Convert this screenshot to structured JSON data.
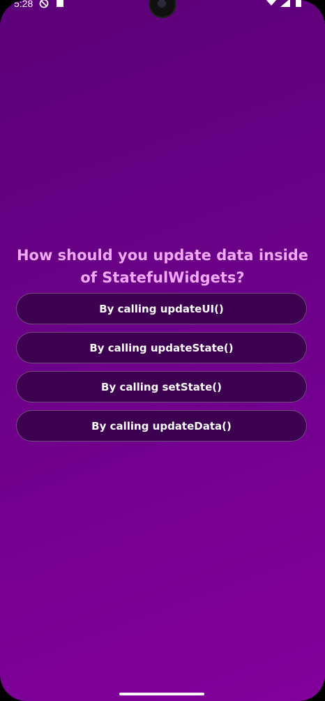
{
  "status": {
    "time": "5:28",
    "icons": [
      "do-not-disturb-icon",
      "sd-card-icon",
      "wifi-icon",
      "signal-icon",
      "battery-icon"
    ]
  },
  "quiz": {
    "question": "How should you update data inside of StatefulWidgets?",
    "answers": [
      "By calling updateUI()",
      "By calling updateState()",
      "By calling setState()",
      "By calling updateData()"
    ]
  },
  "colors": {
    "gradient_top": "#5c0078",
    "gradient_bottom": "#82009c",
    "question_text": "#f0a9f5",
    "button_bg": "#3d0050"
  }
}
